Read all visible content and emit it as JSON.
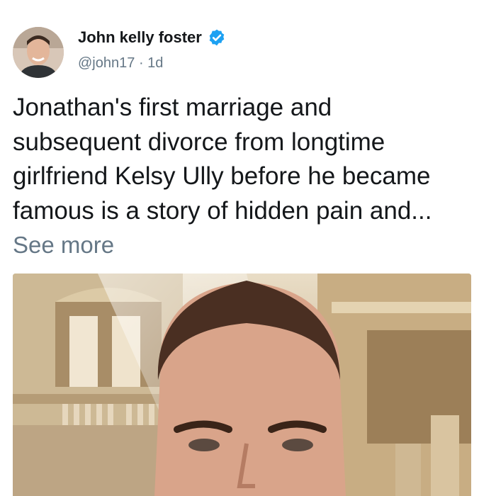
{
  "author": {
    "display_name": "John kelly foster",
    "handle": "@john17",
    "separator": "·",
    "time_ago": "1d",
    "verified": true,
    "verified_color": "#1da1f2"
  },
  "tweet": {
    "text_lines": [
      "Jonathan's first marriage and",
      "subsequent divorce from longtime",
      "girlfriend Kelsy Ully before he became",
      "famous is a story of hidden pain and..."
    ],
    "see_more_label": "See more"
  },
  "media": {
    "type": "photo",
    "icon": "man-selfie-in-courtyard"
  },
  "colors": {
    "text": "#14171a",
    "muted": "#657786",
    "background": "#ffffff"
  }
}
